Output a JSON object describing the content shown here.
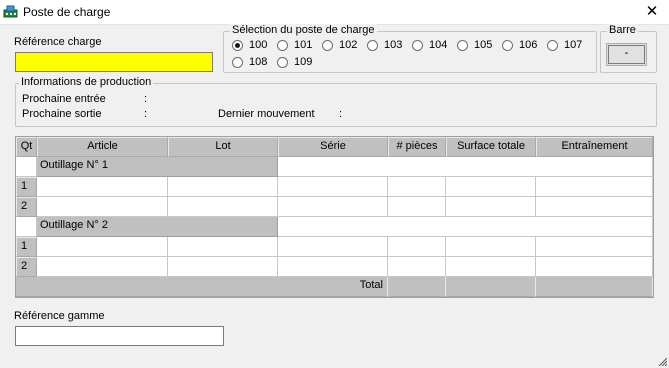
{
  "window": {
    "title": "Poste de charge",
    "close_glyph": "✕",
    "icon": "app-icon"
  },
  "reference_charge": {
    "label": "Référence charge",
    "value": ""
  },
  "selection": {
    "legend": "Sélection du poste de charge",
    "options": [
      "100",
      "101",
      "102",
      "103",
      "104",
      "105",
      "106",
      "107",
      "108",
      "109"
    ],
    "selected": "100"
  },
  "barre": {
    "legend": "Barre",
    "button_label": "-"
  },
  "production": {
    "legend": "Informations de production",
    "prochaine_entree_label": "Prochaine entrée",
    "prochaine_entree_colon": ":",
    "prochaine_sortie_label": "Prochaine sortie",
    "prochaine_sortie_colon": ":",
    "dernier_mouvement_label": "Dernier mouvement",
    "dernier_mouvement_colon": ":"
  },
  "table": {
    "columns": [
      "Qt",
      "Article",
      "Lot",
      "Série",
      "# pièces",
      "Surface totale",
      "Entraînement"
    ],
    "groups": [
      {
        "label": "Outillage N° 1",
        "rows": [
          "1",
          "2"
        ]
      },
      {
        "label": "Outillage N° 2",
        "rows": [
          "1",
          "2"
        ]
      }
    ],
    "total_label": "Total"
  },
  "reference_gamme": {
    "label": "Référence gamme",
    "value": ""
  },
  "colors": {
    "highlight_input": "#ffff00",
    "header_gray": "#c0c0c0",
    "window_bg": "#f0f0f0"
  }
}
